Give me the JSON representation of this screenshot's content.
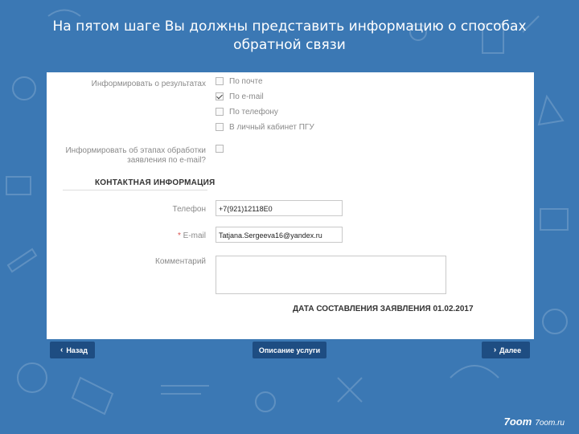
{
  "slide": {
    "title": "На пятом шаге Вы должны представить информацию о способах обратной связи"
  },
  "form": {
    "inform_results_label": "Информировать о результатах",
    "inform_options": [
      {
        "label": "По почте",
        "checked": false
      },
      {
        "label": "По e-mail",
        "checked": true
      },
      {
        "label": "По телефону",
        "checked": false
      },
      {
        "label": "В личный кабинет ПГУ",
        "checked": false
      }
    ],
    "inform_stages_label": "Информировать об этапах обработки заявления по e-mail?",
    "inform_stages_checked": false,
    "contact_section_title": "КОНТАКТНАЯ ИНФОРМАЦИЯ",
    "phone_label": "Телефон",
    "phone_value": "+7(921)12118E0",
    "email_required_mark": "*",
    "email_label": "E-mail",
    "email_value": "Tatjana.Sergeeva16@yandex.ru",
    "comment_label": "Комментарий",
    "comment_value": "",
    "date_line": "ДАТА СОСТАВЛЕНИЯ ЗАЯВЛЕНИЯ 01.02.2017"
  },
  "buttons": {
    "back": "Назад",
    "service_description": "Описание услуги",
    "next": "Далее",
    "back_icon": "chevron-left-icon",
    "next_icon": "chevron-right-icon"
  },
  "branding": {
    "logo_text": "7oom",
    "logo_site": "7oom.ru"
  },
  "colors": {
    "background": "#3b78b4",
    "button": "#1e4d82",
    "required": "#d9534f"
  }
}
